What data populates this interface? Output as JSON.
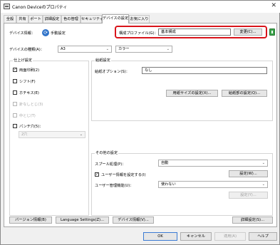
{
  "window": {
    "title": "Canon Deviceのプロパティ",
    "close": "✕"
  },
  "tabs": [
    "全般",
    "共有",
    "ポート",
    "詳細設定",
    "色の管理",
    "セキュリティ",
    "デバイスの設定",
    "お気に入り"
  ],
  "device_info": {
    "label": "デバイス情報：",
    "mode": "手動設定",
    "config_profile_label": "構成プロファイル(G)：",
    "config_profile_value": "基本構成",
    "change_button": "変更(C)..."
  },
  "device_type": {
    "label": "デバイスの種類(A)：",
    "size_value": "A3",
    "color_value": "カラー"
  },
  "finishing": {
    "title": "仕上げ設定",
    "items": [
      {
        "label": "両面印刷(2)",
        "checked": true,
        "enabled": true
      },
      {
        "label": "シフト(F)",
        "checked": false,
        "enabled": true
      },
      {
        "label": "ホチキス(E)",
        "checked": false,
        "enabled": true
      },
      {
        "label": "針なしとじ(3)",
        "checked": false,
        "enabled": false
      },
      {
        "label": "中とじ(T)",
        "checked": false,
        "enabled": false
      },
      {
        "label": "パンチ穴(5)：",
        "checked": false,
        "enabled": true
      }
    ],
    "punch_select": "2穴"
  },
  "paper_feed": {
    "title": "給紙設定",
    "option_label": "給紙オプション(S)：",
    "option_value": "なし",
    "paper_size_button": "用紙サイズの設定(X)...",
    "feed_section_button": "給紙部の設定(Q)..."
  },
  "other": {
    "title": "その他の設定",
    "spool_label": "スプール処理(P)：",
    "spool_value": "自動",
    "user_info_label": "ユーザー情報を設定する(I)",
    "user_info_checked": true,
    "user_info_button": "設定(W)...",
    "user_mgmt_label": "ユーザー管理機能(U)：",
    "user_mgmt_value": "使わない",
    "user_mgmt_button": "設定(Y)..."
  },
  "bottom_buttons": {
    "version": "バージョン情報(B)",
    "language": "Language Settings(Z)...",
    "device_info": "デバイス情報(V)...",
    "advanced": "詳細設定(S)..."
  },
  "dialog_buttons": {
    "ok": "OK",
    "cancel": "キャンセル",
    "apply": "適用(A)",
    "help": "ヘルプ"
  },
  "colors": {
    "highlight": "#d9141b",
    "accent": "#2f73c9"
  },
  "icons": {
    "checkmark": "✓",
    "dropdown": "⌄",
    "sync": "⟳"
  }
}
